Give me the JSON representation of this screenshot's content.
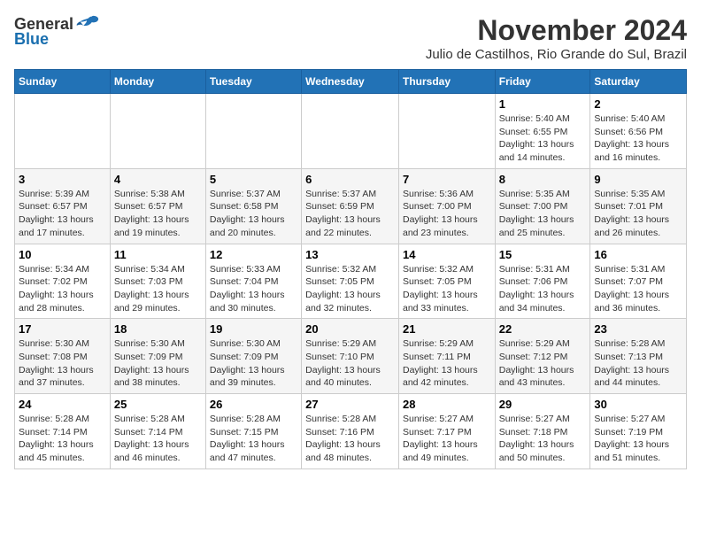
{
  "logo": {
    "general": "General",
    "blue": "Blue"
  },
  "title": "November 2024",
  "subtitle": "Julio de Castilhos, Rio Grande do Sul, Brazil",
  "days_of_week": [
    "Sunday",
    "Monday",
    "Tuesday",
    "Wednesday",
    "Thursday",
    "Friday",
    "Saturday"
  ],
  "weeks": [
    {
      "cells": [
        {
          "day": "",
          "info": ""
        },
        {
          "day": "",
          "info": ""
        },
        {
          "day": "",
          "info": ""
        },
        {
          "day": "",
          "info": ""
        },
        {
          "day": "",
          "info": ""
        },
        {
          "day": "1",
          "info": "Sunrise: 5:40 AM\nSunset: 6:55 PM\nDaylight: 13 hours\nand 14 minutes."
        },
        {
          "day": "2",
          "info": "Sunrise: 5:40 AM\nSunset: 6:56 PM\nDaylight: 13 hours\nand 16 minutes."
        }
      ]
    },
    {
      "cells": [
        {
          "day": "3",
          "info": "Sunrise: 5:39 AM\nSunset: 6:57 PM\nDaylight: 13 hours\nand 17 minutes."
        },
        {
          "day": "4",
          "info": "Sunrise: 5:38 AM\nSunset: 6:57 PM\nDaylight: 13 hours\nand 19 minutes."
        },
        {
          "day": "5",
          "info": "Sunrise: 5:37 AM\nSunset: 6:58 PM\nDaylight: 13 hours\nand 20 minutes."
        },
        {
          "day": "6",
          "info": "Sunrise: 5:37 AM\nSunset: 6:59 PM\nDaylight: 13 hours\nand 22 minutes."
        },
        {
          "day": "7",
          "info": "Sunrise: 5:36 AM\nSunset: 7:00 PM\nDaylight: 13 hours\nand 23 minutes."
        },
        {
          "day": "8",
          "info": "Sunrise: 5:35 AM\nSunset: 7:00 PM\nDaylight: 13 hours\nand 25 minutes."
        },
        {
          "day": "9",
          "info": "Sunrise: 5:35 AM\nSunset: 7:01 PM\nDaylight: 13 hours\nand 26 minutes."
        }
      ]
    },
    {
      "cells": [
        {
          "day": "10",
          "info": "Sunrise: 5:34 AM\nSunset: 7:02 PM\nDaylight: 13 hours\nand 28 minutes."
        },
        {
          "day": "11",
          "info": "Sunrise: 5:34 AM\nSunset: 7:03 PM\nDaylight: 13 hours\nand 29 minutes."
        },
        {
          "day": "12",
          "info": "Sunrise: 5:33 AM\nSunset: 7:04 PM\nDaylight: 13 hours\nand 30 minutes."
        },
        {
          "day": "13",
          "info": "Sunrise: 5:32 AM\nSunset: 7:05 PM\nDaylight: 13 hours\nand 32 minutes."
        },
        {
          "day": "14",
          "info": "Sunrise: 5:32 AM\nSunset: 7:05 PM\nDaylight: 13 hours\nand 33 minutes."
        },
        {
          "day": "15",
          "info": "Sunrise: 5:31 AM\nSunset: 7:06 PM\nDaylight: 13 hours\nand 34 minutes."
        },
        {
          "day": "16",
          "info": "Sunrise: 5:31 AM\nSunset: 7:07 PM\nDaylight: 13 hours\nand 36 minutes."
        }
      ]
    },
    {
      "cells": [
        {
          "day": "17",
          "info": "Sunrise: 5:30 AM\nSunset: 7:08 PM\nDaylight: 13 hours\nand 37 minutes."
        },
        {
          "day": "18",
          "info": "Sunrise: 5:30 AM\nSunset: 7:09 PM\nDaylight: 13 hours\nand 38 minutes."
        },
        {
          "day": "19",
          "info": "Sunrise: 5:30 AM\nSunset: 7:09 PM\nDaylight: 13 hours\nand 39 minutes."
        },
        {
          "day": "20",
          "info": "Sunrise: 5:29 AM\nSunset: 7:10 PM\nDaylight: 13 hours\nand 40 minutes."
        },
        {
          "day": "21",
          "info": "Sunrise: 5:29 AM\nSunset: 7:11 PM\nDaylight: 13 hours\nand 42 minutes."
        },
        {
          "day": "22",
          "info": "Sunrise: 5:29 AM\nSunset: 7:12 PM\nDaylight: 13 hours\nand 43 minutes."
        },
        {
          "day": "23",
          "info": "Sunrise: 5:28 AM\nSunset: 7:13 PM\nDaylight: 13 hours\nand 44 minutes."
        }
      ]
    },
    {
      "cells": [
        {
          "day": "24",
          "info": "Sunrise: 5:28 AM\nSunset: 7:14 PM\nDaylight: 13 hours\nand 45 minutes."
        },
        {
          "day": "25",
          "info": "Sunrise: 5:28 AM\nSunset: 7:14 PM\nDaylight: 13 hours\nand 46 minutes."
        },
        {
          "day": "26",
          "info": "Sunrise: 5:28 AM\nSunset: 7:15 PM\nDaylight: 13 hours\nand 47 minutes."
        },
        {
          "day": "27",
          "info": "Sunrise: 5:28 AM\nSunset: 7:16 PM\nDaylight: 13 hours\nand 48 minutes."
        },
        {
          "day": "28",
          "info": "Sunrise: 5:27 AM\nSunset: 7:17 PM\nDaylight: 13 hours\nand 49 minutes."
        },
        {
          "day": "29",
          "info": "Sunrise: 5:27 AM\nSunset: 7:18 PM\nDaylight: 13 hours\nand 50 minutes."
        },
        {
          "day": "30",
          "info": "Sunrise: 5:27 AM\nSunset: 7:19 PM\nDaylight: 13 hours\nand 51 minutes."
        }
      ]
    }
  ]
}
